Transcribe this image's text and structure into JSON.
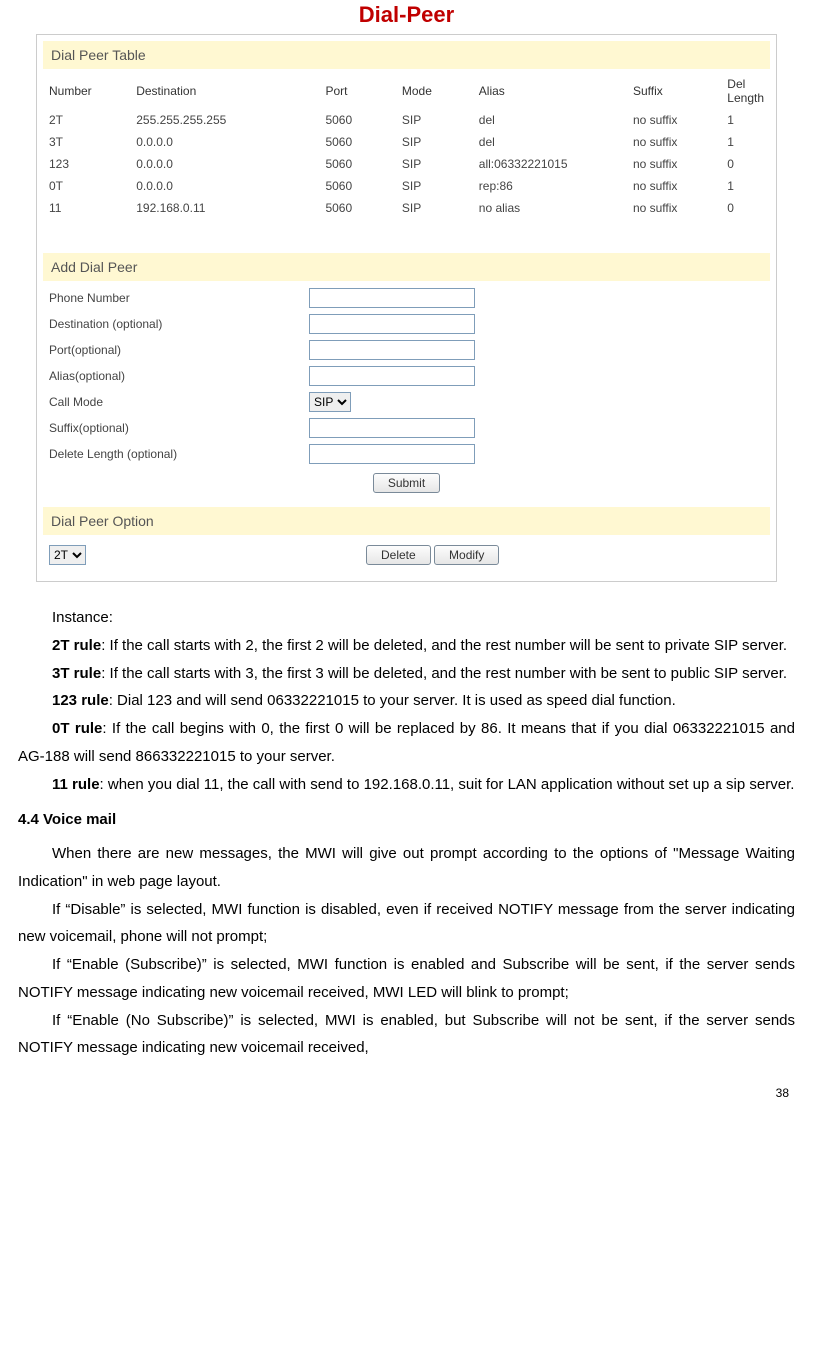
{
  "title": "Dial-Peer",
  "table": {
    "header": "Dial Peer Table",
    "columns": [
      "Number",
      "Destination",
      "Port",
      "Mode",
      "Alias",
      "Suffix",
      "Del Length"
    ],
    "rows": [
      {
        "number": "2T",
        "dest": "255.255.255.255",
        "port": "5060",
        "mode": "SIP",
        "alias": "del",
        "suffix": "no suffix",
        "del": "1"
      },
      {
        "number": "3T",
        "dest": "0.0.0.0",
        "port": "5060",
        "mode": "SIP",
        "alias": "del",
        "suffix": "no suffix",
        "del": "1"
      },
      {
        "number": "123",
        "dest": "0.0.0.0",
        "port": "5060",
        "mode": "SIP",
        "alias": "all:06332221015",
        "suffix": "no suffix",
        "del": "0"
      },
      {
        "number": "0T",
        "dest": "0.0.0.0",
        "port": "5060",
        "mode": "SIP",
        "alias": "rep:86",
        "suffix": "no suffix",
        "del": "1"
      },
      {
        "number": "11",
        "dest": "192.168.0.11",
        "port": "5060",
        "mode": "SIP",
        "alias": "no alias",
        "suffix": "no suffix",
        "del": "0"
      }
    ]
  },
  "form": {
    "header": "Add Dial Peer",
    "fields": {
      "phone": "Phone Number",
      "dest": "Destination (optional)",
      "port": "Port(optional)",
      "alias": "Alias(optional)",
      "callmode": "Call Mode",
      "suffix": "Suffix(optional)",
      "dellen": "Delete Length (optional)"
    },
    "callmode_value": "SIP",
    "submit": "Submit"
  },
  "option": {
    "header": "Dial Peer Option",
    "selected": "2T",
    "delete": "Delete",
    "modify": "Modify"
  },
  "text": {
    "instance": "Instance:",
    "r2t_b": "2T rule",
    "r2t": ": If the call starts with 2, the first 2 will be deleted, and the rest number will be sent to private SIP server.",
    "r3t_b": "3T rule",
    "r3t": ": If the call starts with 3, the first 3 will be deleted, and the rest number with be sent to public SIP server.",
    "r123_b": "123 rule",
    "r123": ": Dial 123 and will send 06332221015 to your server. It is used as speed dial function.",
    "r0t_b": "0T rule",
    "r0t": ": If the call begins with 0, the first 0 will be replaced by 86. It means that if you dial 06332221015 and AG-188 will send 866332221015 to your server.",
    "r11_b": "11 rule",
    "r11": ": when you dial 11, the call with send to 192.168.0.11, suit for LAN application without set up a sip server.",
    "sec44": "4.4 Voice mail",
    "vm1": "When there are new messages, the MWI will give out prompt according to the options of \"Message Waiting Indication\" in web page layout.",
    "vm2": "If “Disable” is selected, MWI function is disabled, even if received NOTIFY message from the server indicating new voicemail, phone will not prompt;",
    "vm3": "If “Enable (Subscribe)” is selected, MWI function is enabled and Subscribe will be sent, if the server sends NOTIFY message indicating new voicemail received, MWI LED will blink to prompt;",
    "vm4": "  If “Enable (No Subscribe)” is selected, MWI is enabled, but Subscribe will not be sent, if the server sends NOTIFY message indicating new voicemail received,"
  },
  "pagenum": "38"
}
